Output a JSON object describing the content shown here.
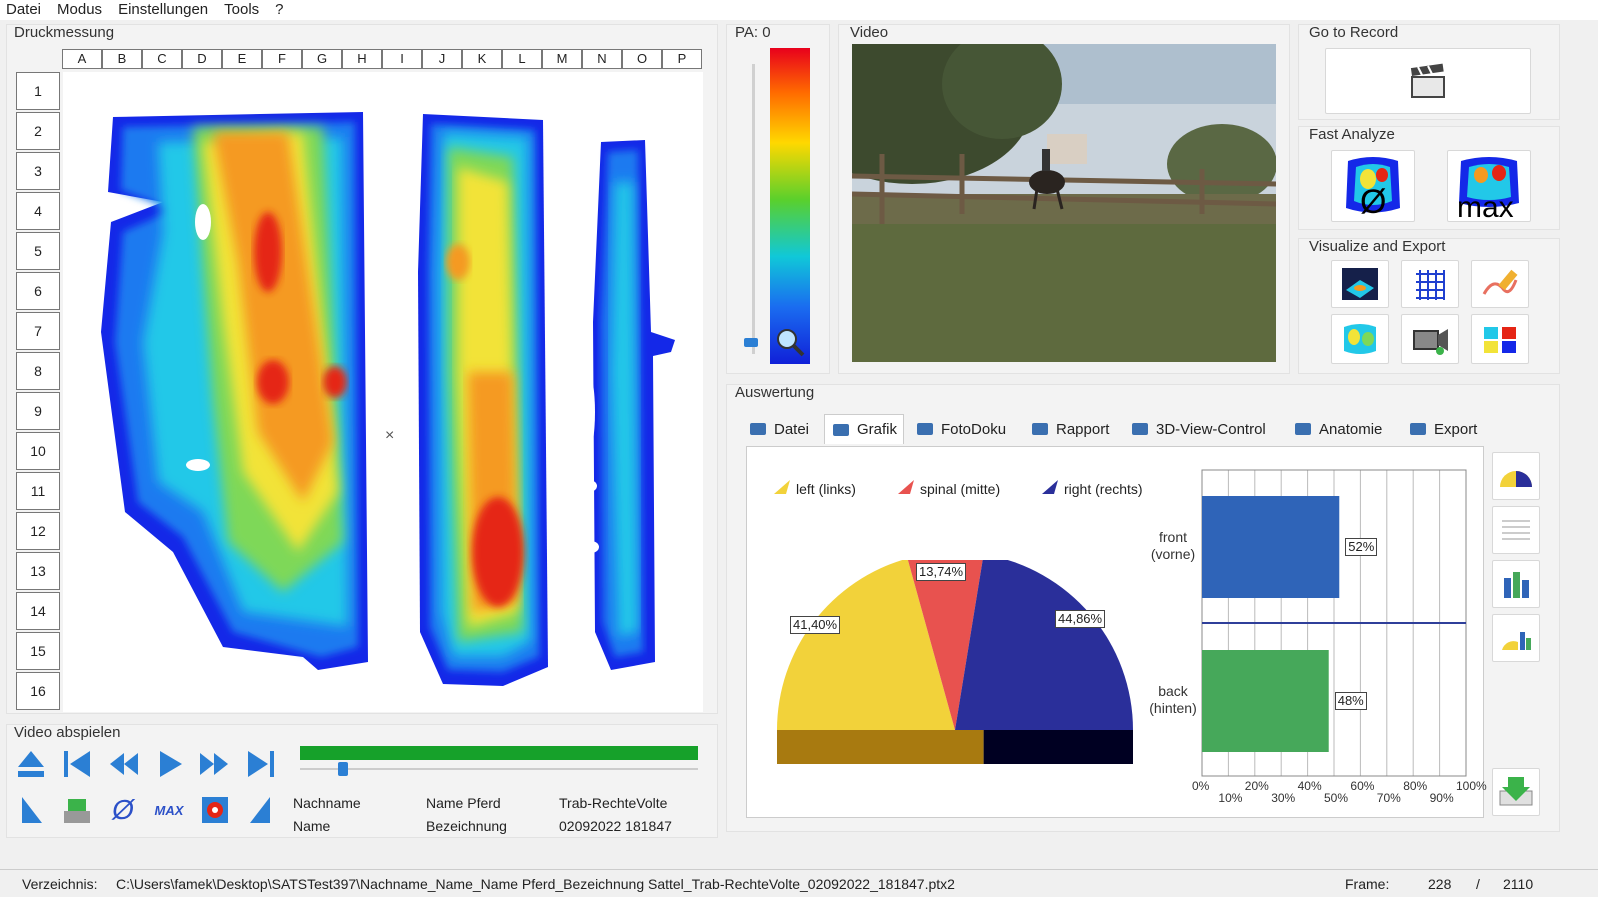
{
  "menu": [
    "Datei",
    "Modus",
    "Einstellungen",
    "Tools",
    "?"
  ],
  "pressure": {
    "title": "Druckmessung",
    "columns": [
      "A",
      "B",
      "C",
      "D",
      "E",
      "F",
      "G",
      "H",
      "I",
      "J",
      "K",
      "L",
      "M",
      "N",
      "O",
      "P"
    ],
    "rows": [
      "1",
      "2",
      "3",
      "4",
      "5",
      "6",
      "7",
      "8",
      "9",
      "10",
      "11",
      "12",
      "13",
      "14",
      "15",
      "16"
    ],
    "center_mark": "×"
  },
  "scale": {
    "title": "PA: 0"
  },
  "video": {
    "title": "Video"
  },
  "goto": {
    "title": "Go to Record",
    "icon": "clapperboard-icon"
  },
  "fast": {
    "title": "Fast Analyze",
    "avg_label": "Ø",
    "max_label": "max"
  },
  "visualize": {
    "title": "Visualize and Export"
  },
  "auswertung": {
    "title": "Auswertung",
    "tabs": [
      {
        "label": "Datei",
        "icon": "disk-icon"
      },
      {
        "label": "Grafik",
        "icon": "chart-icon"
      },
      {
        "label": "FotoDoku",
        "icon": "photo-icon"
      },
      {
        "label": "Rapport",
        "icon": "report-icon"
      },
      {
        "label": "3D-View-Control",
        "icon": "horse-icon"
      },
      {
        "label": "Anatomie",
        "icon": "horse-icon"
      },
      {
        "label": "Export",
        "icon": "monitor-icon"
      }
    ],
    "active_tab": "Grafik"
  },
  "chart_data": [
    {
      "type": "pie",
      "variant": "half-donut",
      "legend": [
        "left (links)",
        "spinal (mitte)",
        "right (rechts)"
      ],
      "slices": [
        {
          "name": "left (links)",
          "value": 41.4,
          "label": "41,40%",
          "color": "#f2d23a"
        },
        {
          "name": "spinal (mitte)",
          "value": 13.74,
          "label": "13,74%",
          "color": "#e8524f"
        },
        {
          "name": "right (rechts)",
          "value": 44.86,
          "label": "44,86%",
          "color": "#2a2f9a"
        }
      ]
    },
    {
      "type": "bar",
      "orientation": "horizontal",
      "categories": [
        "front\n(vorne)",
        "back\n(hinten)"
      ],
      "values": [
        52,
        48
      ],
      "labels": [
        "52%",
        "48%"
      ],
      "colors": [
        "#2f64b8",
        "#46a85a"
      ],
      "xlim": [
        0,
        100
      ],
      "ticks_top": [
        "0%",
        "20%",
        "40%",
        "60%",
        "80%",
        "100%"
      ],
      "ticks_bottom": [
        "10%",
        "30%",
        "50%",
        "70%",
        "90%"
      ]
    }
  ],
  "playback": {
    "title": "Video abspielen",
    "progress": 1.0,
    "position": 0.108,
    "info": [
      [
        "Nachname",
        "Name Pferd",
        "Trab-RechteVolte"
      ],
      [
        "Name",
        "Bezeichnung",
        "02092022 181847"
      ]
    ],
    "avg_symbol": "Ø",
    "max_symbol": "MAX"
  },
  "status": {
    "dir_label": "Verzeichnis:",
    "path": "C:\\Users\\famek\\Desktop\\SATSTest397\\Nachname_Name_Name Pferd_Bezeichnung Sattel_Trab-RechteVolte_02092022_181847.ptx2",
    "frame_label": "Frame:",
    "frame": "228",
    "sep": "/",
    "total": "2110"
  }
}
